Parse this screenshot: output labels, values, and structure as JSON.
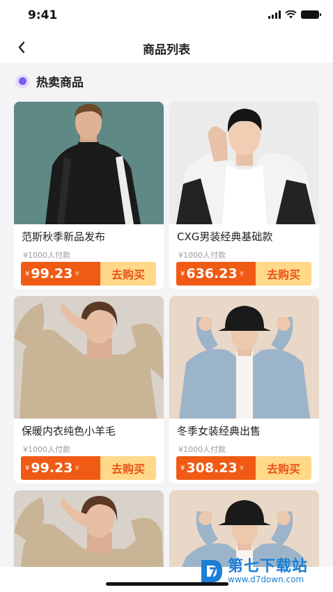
{
  "status": {
    "time": "9:41"
  },
  "nav": {
    "title": "商品列表"
  },
  "section": {
    "title": "热卖商品"
  },
  "products": [
    {
      "title": "范斯秋季新品发布",
      "sales": "¥1000人付款",
      "yen": "¥",
      "price": "99.23",
      "unit": "¥",
      "buy_label": "去购买"
    },
    {
      "title": "CXG男装经典基础款",
      "sales": "¥1000人付款",
      "yen": "¥",
      "price": "636.23",
      "unit": "¥",
      "buy_label": "去购买"
    },
    {
      "title": "保暖内衣纯色小羊毛",
      "sales": "¥1000人付款",
      "yen": "¥",
      "price": "99.23",
      "unit": "¥",
      "buy_label": "去购买"
    },
    {
      "title": "冬季女装经典出售",
      "sales": "¥1000人付款",
      "yen": "¥",
      "price": "308.23",
      "unit": "¥",
      "buy_label": "去购买"
    }
  ],
  "watermark": {
    "main": "第七下载站",
    "sub": "www.d7down.com"
  },
  "colors": {
    "accent": "#7b5cf0",
    "price_bg": "#f05a14",
    "buy_bg": "#ffd888",
    "buy_text": "#e8541a"
  }
}
